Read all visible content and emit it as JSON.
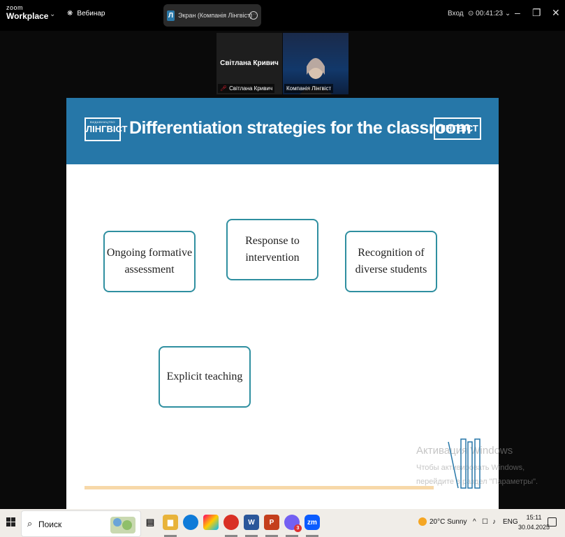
{
  "app": {
    "brand_top": "zoom",
    "brand_bottom": "Workplace",
    "webinar_label": "Вебинар",
    "screen_tab_label": "Экран (Компанія Лінгвіст)",
    "login_label": "Вход",
    "timer": "00:41:23"
  },
  "participants": [
    {
      "big_name": "Світлана Кривич",
      "label": "Світлана Кривич"
    },
    {
      "label": "Компанія Лінгвіст"
    }
  ],
  "slide": {
    "title": "Differentiation strategies for the classroom",
    "logo_left_small": "ВИДАВНИЦТВО",
    "logo_text": "ЛІНГВІСТ",
    "boxes": [
      {
        "line1": "Ongoing formative",
        "line2": "assessment"
      },
      {
        "line1": "Response to",
        "line2": "intervention"
      },
      {
        "line1": "Recognition of",
        "line2": "diverse students"
      },
      {
        "line1": "Explicit teaching",
        "line2": ""
      }
    ]
  },
  "watermark": {
    "title": "Активация Windows",
    "text": "Чтобы активировать Windows, перейдите в раздел \"Параметры\"."
  },
  "taskbar": {
    "search_label": "Поиск",
    "weather": "20°C  Sunny",
    "lang": "ENG",
    "time": "15:11",
    "date": "30.04.2025",
    "badge_count": "3",
    "colors": {
      "edge": "#0f7bd8",
      "chrome": "#d93025",
      "word": "#2b579a",
      "ppt": "#c43e1c",
      "zoom": "#0b5cff",
      "viber": "#7360f2"
    }
  }
}
